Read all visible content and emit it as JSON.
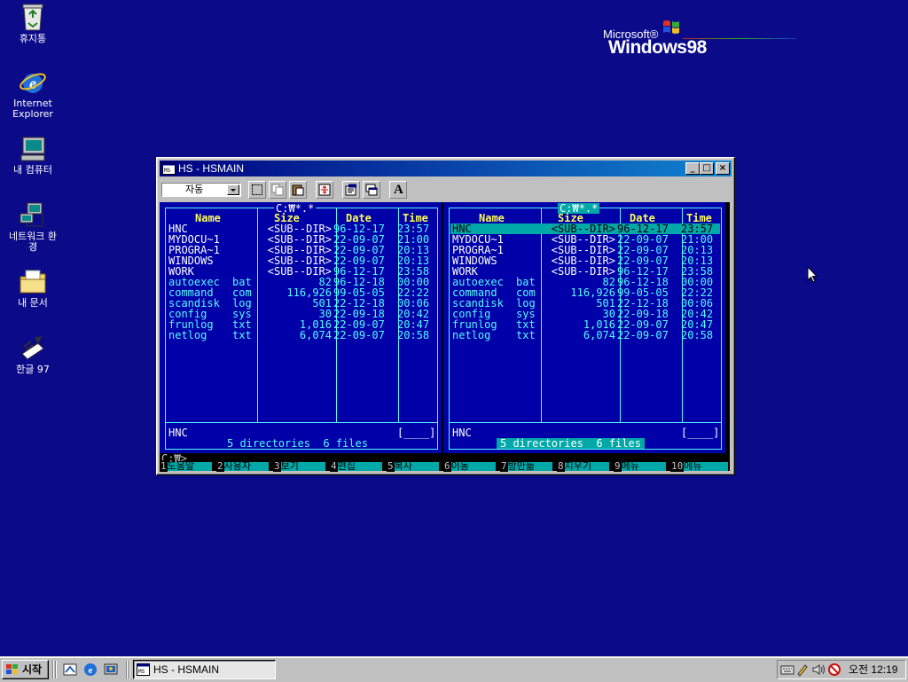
{
  "desktop": {
    "icons": [
      {
        "label": "휴지통",
        "icon": "recycle-bin-icon"
      },
      {
        "label": "Internet Explorer",
        "icon": "internet-explorer-icon"
      },
      {
        "label": "내 컴퓨터",
        "icon": "my-computer-icon"
      },
      {
        "label": "네트워크 환경",
        "icon": "network-neighborhood-icon"
      },
      {
        "label": "내 문서",
        "icon": "my-documents-icon"
      },
      {
        "label": "한글 97",
        "icon": "hangul-97-icon"
      }
    ],
    "logo": {
      "microsoft": "Microsoft®",
      "windows": "Windows98"
    }
  },
  "window": {
    "title": "HS - HSMAIN",
    "buttons": {
      "minimize": "_",
      "maximize": "□",
      "close": "×"
    },
    "toolbar": {
      "font_select": "자동",
      "tools": [
        "select-icon",
        "copy-icon",
        "paste-icon",
        "fullscreen-icon",
        "properties-icon",
        "background-icon",
        "font-icon"
      ],
      "font_button_label": "A"
    }
  },
  "panels": [
    {
      "path": "C:₩*.*",
      "active": false,
      "headers": {
        "name": "Name",
        "size": "Size",
        "date": "Date",
        "time": "Time"
      },
      "rows": [
        {
          "name": "HNC",
          "ext": "",
          "size": "<SUB--DIR>",
          "date": "96-12-17",
          "time": "23:57",
          "dir": true,
          "selected": false
        },
        {
          "name": "MYDOCU~1",
          "ext": "",
          "size": "<SUB--DIR>",
          "date": "22-09-07",
          "time": "21:00",
          "dir": true,
          "selected": false
        },
        {
          "name": "PROGRA~1",
          "ext": "",
          "size": "<SUB--DIR>",
          "date": "22-09-07",
          "time": "20:13",
          "dir": true,
          "selected": false
        },
        {
          "name": "WINDOWS",
          "ext": "",
          "size": "<SUB--DIR>",
          "date": "22-09-07",
          "time": "20:13",
          "dir": true,
          "selected": false
        },
        {
          "name": "WORK",
          "ext": "",
          "size": "<SUB--DIR>",
          "date": "96-12-17",
          "time": "23:58",
          "dir": true,
          "selected": false
        },
        {
          "name": "autoexec",
          "ext": "bat",
          "size": "82",
          "date": "96-12-18",
          "time": "00:00",
          "dir": false,
          "selected": false
        },
        {
          "name": "command",
          "ext": "com",
          "size": "116,926",
          "date": "99-05-05",
          "time": "22:22",
          "dir": false,
          "selected": false
        },
        {
          "name": "scandisk",
          "ext": "log",
          "size": "501",
          "date": "22-12-18",
          "time": "00:06",
          "dir": false,
          "selected": false
        },
        {
          "name": "config",
          "ext": "sys",
          "size": "30",
          "date": "22-09-18",
          "time": "20:42",
          "dir": false,
          "selected": false
        },
        {
          "name": "frunlog",
          "ext": "txt",
          "size": "1,016",
          "date": "22-09-07",
          "time": "20:47",
          "dir": false,
          "selected": false
        },
        {
          "name": "netlog",
          "ext": "txt",
          "size": "6,074",
          "date": "22-09-07",
          "time": "20:58",
          "dir": false,
          "selected": false
        }
      ],
      "status_name": "HNC",
      "bracket": "[____]",
      "summary": "5 directories  6 files"
    },
    {
      "path": "C:₩*.*",
      "active": true,
      "headers": {
        "name": "Name",
        "size": "Size",
        "date": "Date",
        "time": "Time"
      },
      "rows": [
        {
          "name": "HNC",
          "ext": "",
          "size": "<SUB--DIR>",
          "date": "96-12-17",
          "time": "23:57",
          "dir": true,
          "selected": true
        },
        {
          "name": "MYDOCU~1",
          "ext": "",
          "size": "<SUB--DIR>",
          "date": "22-09-07",
          "time": "21:00",
          "dir": true,
          "selected": false
        },
        {
          "name": "PROGRA~1",
          "ext": "",
          "size": "<SUB--DIR>",
          "date": "22-09-07",
          "time": "20:13",
          "dir": true,
          "selected": false
        },
        {
          "name": "WINDOWS",
          "ext": "",
          "size": "<SUB--DIR>",
          "date": "22-09-07",
          "time": "20:13",
          "dir": true,
          "selected": false
        },
        {
          "name": "WORK",
          "ext": "",
          "size": "<SUB--DIR>",
          "date": "96-12-17",
          "time": "23:58",
          "dir": true,
          "selected": false
        },
        {
          "name": "autoexec",
          "ext": "bat",
          "size": "82",
          "date": "96-12-18",
          "time": "00:00",
          "dir": false,
          "selected": false
        },
        {
          "name": "command",
          "ext": "com",
          "size": "116,926",
          "date": "99-05-05",
          "time": "22:22",
          "dir": false,
          "selected": false
        },
        {
          "name": "scandisk",
          "ext": "log",
          "size": "501",
          "date": "22-12-18",
          "time": "00:06",
          "dir": false,
          "selected": false
        },
        {
          "name": "config",
          "ext": "sys",
          "size": "30",
          "date": "22-09-18",
          "time": "20:42",
          "dir": false,
          "selected": false
        },
        {
          "name": "frunlog",
          "ext": "txt",
          "size": "1,016",
          "date": "22-09-07",
          "time": "20:47",
          "dir": false,
          "selected": false
        },
        {
          "name": "netlog",
          "ext": "txt",
          "size": "6,074",
          "date": "22-09-07",
          "time": "20:58",
          "dir": false,
          "selected": false
        }
      ],
      "status_name": "HNC",
      "bracket": "[____]",
      "summary": "5 directories  6 files"
    }
  ],
  "prompt": "C:₩>_",
  "fkeys": [
    {
      "num": "1",
      "label": "도움말"
    },
    {
      "num": "2",
      "label": "사용자"
    },
    {
      "num": "3",
      "label": "보기"
    },
    {
      "num": "4",
      "label": "편집"
    },
    {
      "num": "5",
      "label": "복사"
    },
    {
      "num": "6",
      "label": "이동"
    },
    {
      "num": "7",
      "label": "방만듦"
    },
    {
      "num": "8",
      "label": "지우기"
    },
    {
      "num": "9",
      "label": "메뉴"
    },
    {
      "num": "10",
      "label": "메뉴"
    }
  ],
  "taskbar": {
    "start_label": "시작",
    "quick_launch": [
      "show-desktop-icon",
      "internet-explorer-icon",
      "channels-icon"
    ],
    "tasks": [
      {
        "label": "HS - HSMAIN",
        "icon": "dos-window-icon"
      }
    ],
    "tray_icons": [
      "keyboard-icon",
      "ime-pen-icon",
      "volume-icon",
      "stop-icon"
    ],
    "clock": "오전 12:19"
  },
  "colors": {
    "desktop": "#0b0b8a",
    "panel_bg": "#0000a8",
    "panel_fg": "#54fcfc",
    "header_fg": "#fcfc54",
    "highlight": "#00a8a8",
    "title_active_start": "#000080",
    "title_active_end": "#1084d0"
  }
}
